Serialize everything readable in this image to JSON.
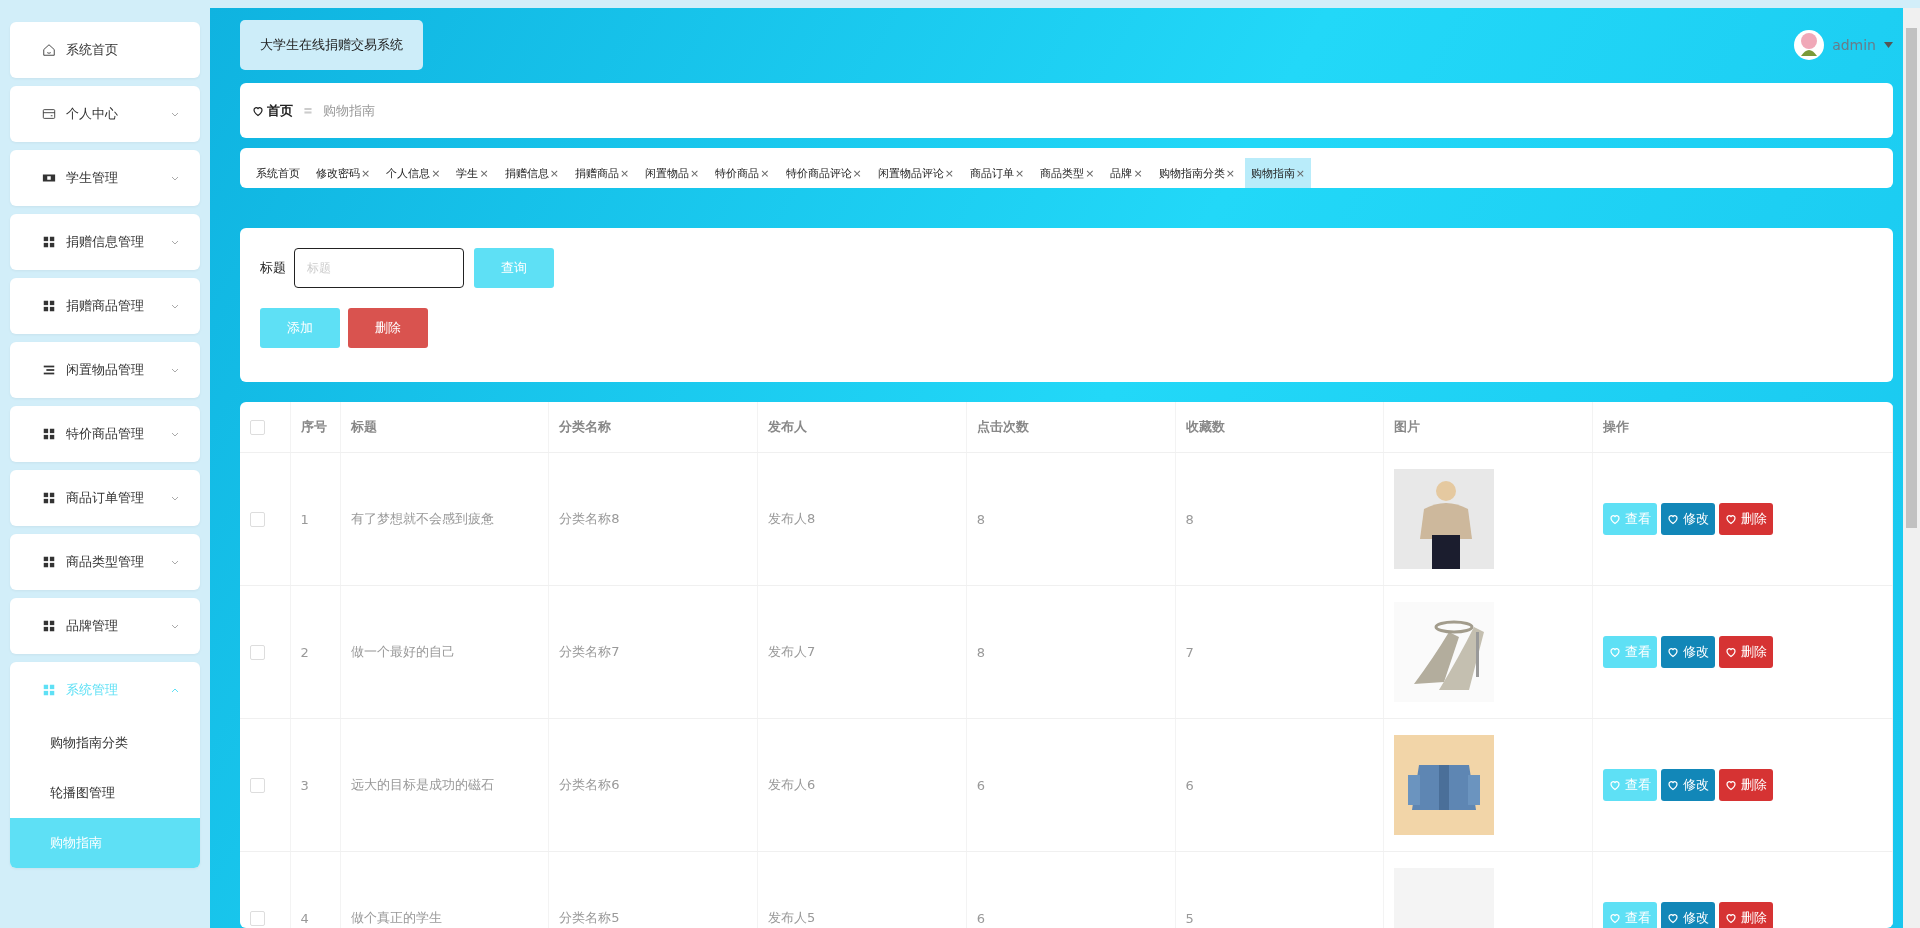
{
  "sidebar": {
    "items": [
      {
        "label": "系统首页",
        "kind": "home",
        "expandable": false,
        "expanded": false
      },
      {
        "label": "个人中心",
        "kind": "card",
        "expandable": true,
        "expanded": false
      },
      {
        "label": "学生管理",
        "kind": "film",
        "expandable": true,
        "expanded": false
      },
      {
        "label": "捐赠信息管理",
        "kind": "grid",
        "expandable": true,
        "expanded": false
      },
      {
        "label": "捐赠商品管理",
        "kind": "grid",
        "expandable": true,
        "expanded": false
      },
      {
        "label": "闲置物品管理",
        "kind": "list",
        "expandable": true,
        "expanded": false
      },
      {
        "label": "特价商品管理",
        "kind": "grid",
        "expandable": true,
        "expanded": false
      },
      {
        "label": "商品订单管理",
        "kind": "grid",
        "expandable": true,
        "expanded": false
      },
      {
        "label": "商品类型管理",
        "kind": "grid",
        "expandable": true,
        "expanded": false
      },
      {
        "label": "品牌管理",
        "kind": "grid",
        "expandable": true,
        "expanded": false
      },
      {
        "label": "系统管理",
        "kind": "grid",
        "expandable": true,
        "expanded": true,
        "children": [
          {
            "label": "购物指南分类",
            "selected": false
          },
          {
            "label": "轮播图管理",
            "selected": false
          },
          {
            "label": "购物指南",
            "selected": true
          }
        ]
      }
    ]
  },
  "header": {
    "title": "大学生在线捐赠交易系统",
    "user": "admin"
  },
  "breadcrumb": {
    "home": "首页",
    "separator": "〓",
    "current": "购物指南"
  },
  "tabs": [
    {
      "label": "系统首页",
      "selected": false
    },
    {
      "label": "修改密码",
      "close": "×",
      "selected": false
    },
    {
      "label": "个人信息",
      "close": "×",
      "selected": false
    },
    {
      "label": "学生",
      "close": "×",
      "selected": false
    },
    {
      "label": "捐赠信息",
      "close": "×",
      "selected": false
    },
    {
      "label": "捐赠商品",
      "close": "×",
      "selected": false
    },
    {
      "label": "闲置物品",
      "close": "×",
      "selected": false
    },
    {
      "label": "特价商品",
      "close": "×",
      "selected": false
    },
    {
      "label": "特价商品评论",
      "close": "×",
      "selected": false
    },
    {
      "label": "闲置物品评论",
      "close": "×",
      "selected": false
    },
    {
      "label": "商品订单",
      "close": "×",
      "selected": false
    },
    {
      "label": "商品类型",
      "close": "×",
      "selected": false
    },
    {
      "label": "品牌",
      "close": "×",
      "selected": false
    },
    {
      "label": "购物指南分类",
      "close": "×",
      "selected": false
    },
    {
      "label": "购物指南",
      "close": "×",
      "selected": true
    }
  ],
  "search": {
    "label": "标题",
    "placeholder": "标题",
    "button": "查询"
  },
  "actions": [
    {
      "label": "添加",
      "kind": "add"
    },
    {
      "label": "删除",
      "kind": "delete"
    }
  ],
  "table": {
    "select_all": {
      "checked": false
    },
    "columns": [
      "序号",
      "标题",
      "分类名称",
      "发布人",
      "点击次数",
      "收藏数",
      "图片",
      "操作"
    ],
    "rows": [
      {
        "checked": false,
        "cells": [
          "1",
          "有了梦想就不会感到疲惫",
          "分类名称8",
          "发布人8",
          "8",
          "8"
        ],
        "picture": {
          "kind": "picture"
        },
        "actions": [
          {
            "label": "查看",
            "kind": "view"
          },
          {
            "label": "修改",
            "kind": "edit"
          },
          {
            "label": "删除",
            "kind": "delete"
          }
        ]
      },
      {
        "checked": false,
        "cells": [
          "2",
          "做一个最好的自己",
          "分类名称7",
          "发布人7",
          "8",
          "7"
        ],
        "picture": {
          "kind": "picture"
        },
        "actions": [
          {
            "label": "查看",
            "kind": "view"
          },
          {
            "label": "修改",
            "kind": "edit"
          },
          {
            "label": "删除",
            "kind": "delete"
          }
        ]
      },
      {
        "checked": false,
        "cells": [
          "3",
          "远大的目标是成功的磁石",
          "分类名称6",
          "发布人6",
          "6",
          "6"
        ],
        "picture": {
          "kind": "picture"
        },
        "actions": [
          {
            "label": "查看",
            "kind": "view"
          },
          {
            "label": "修改",
            "kind": "edit"
          },
          {
            "label": "删除",
            "kind": "delete"
          }
        ]
      },
      {
        "checked": false,
        "cells": [
          "4",
          "做个真正的学生",
          "分类名称5",
          "发布人5",
          "6",
          "5"
        ],
        "picture": {
          "kind": "picture"
        },
        "actions": [
          {
            "label": "查看",
            "kind": "view"
          },
          {
            "label": "修改",
            "kind": "edit"
          },
          {
            "label": "删除",
            "kind": "delete"
          }
        ]
      }
    ]
  }
}
